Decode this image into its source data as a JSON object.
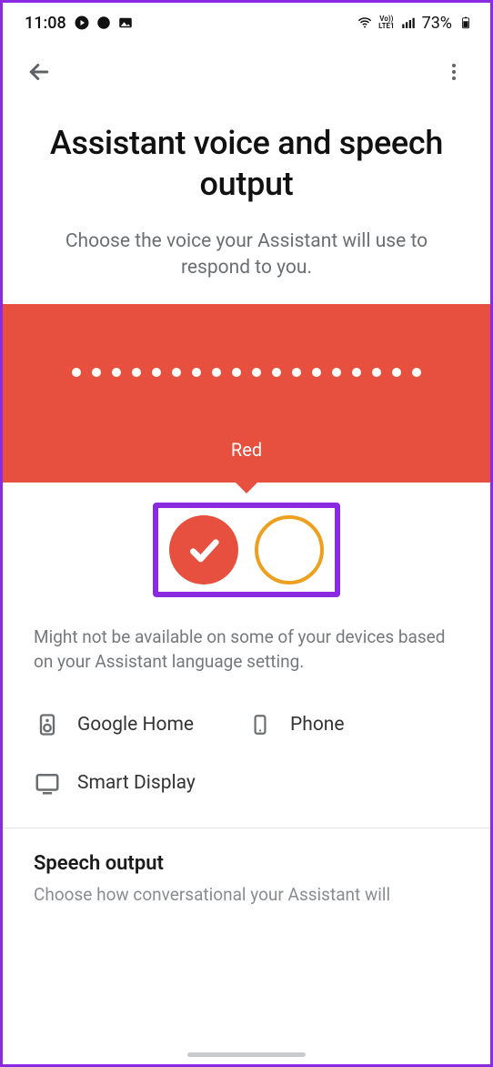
{
  "statusbar": {
    "time": "11:08",
    "battery": "73%"
  },
  "header": {
    "title": "Assistant voice and speech output",
    "subtitle": "Choose the voice your Assistant will use to respond to you."
  },
  "voice": {
    "selected_label": "Red",
    "dot_count": 18,
    "options": [
      {
        "name": "Red",
        "selected": true
      },
      {
        "name": "Orange",
        "selected": false
      }
    ]
  },
  "disclaimer": "Might not be available on some of your devices based on your Assistant language setting.",
  "devices": [
    {
      "icon": "speaker-icon",
      "label": "Google Home"
    },
    {
      "icon": "phone-icon",
      "label": "Phone"
    },
    {
      "icon": "smartdisplay-icon",
      "label": "Smart Display"
    }
  ],
  "section": {
    "title": "Speech output",
    "subtitle": "Choose how conversational your Assistant will"
  }
}
